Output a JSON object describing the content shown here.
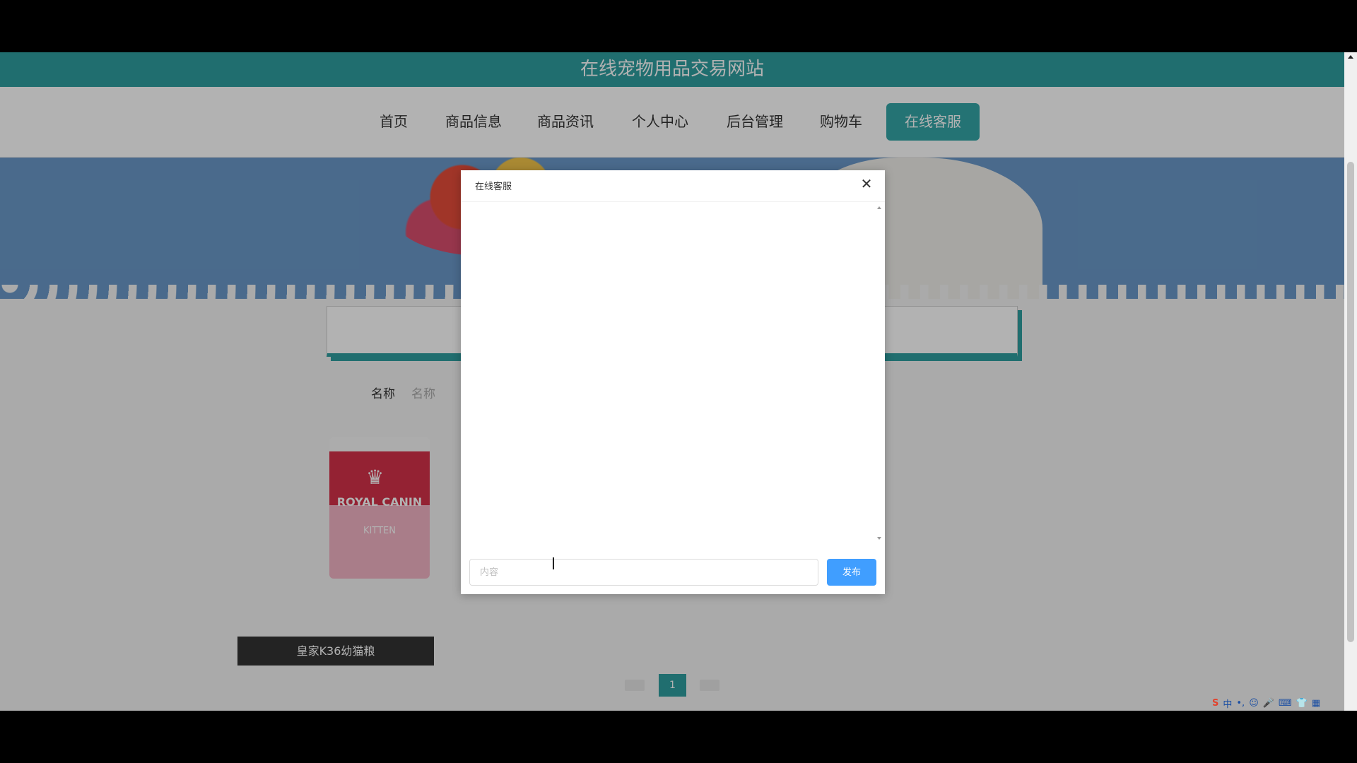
{
  "header": {
    "title": "在线宠物用品交易网站"
  },
  "nav": {
    "items": [
      {
        "label": "首页"
      },
      {
        "label": "商品信息"
      },
      {
        "label": "商品资讯"
      },
      {
        "label": "个人中心"
      },
      {
        "label": "后台管理"
      },
      {
        "label": "购物车"
      },
      {
        "label": "在线客服",
        "active": true
      }
    ]
  },
  "filter": {
    "label": "名称",
    "placeholder": "名称"
  },
  "products": [
    {
      "name": "皇家K36幼猫粮",
      "image_brand": "ROYAL CANIN",
      "image_sub": "KITTEN"
    }
  ],
  "pagination": {
    "current": "1"
  },
  "dialog": {
    "title": "在线客服",
    "input_placeholder": "内容",
    "send_label": "发布"
  },
  "colors": {
    "accent": "#2f9ea0",
    "send_button": "#409eff"
  }
}
